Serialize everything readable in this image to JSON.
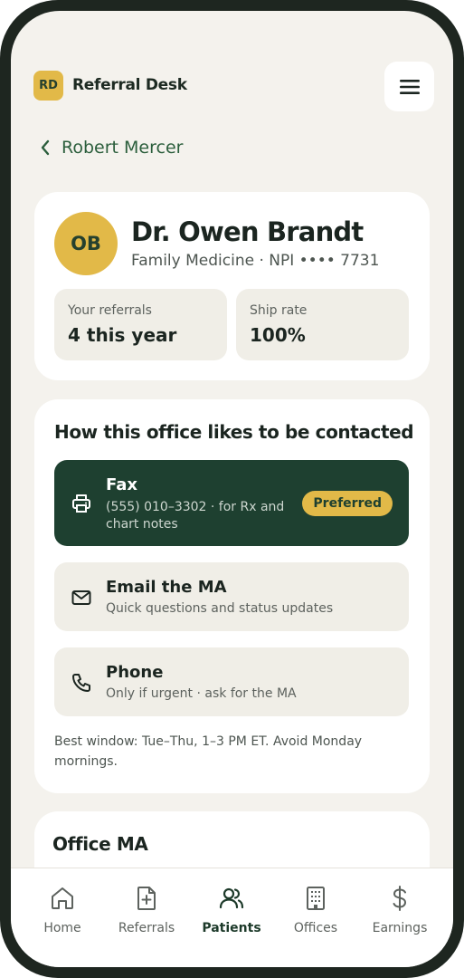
{
  "header": {
    "logo_initials": "RD",
    "app_name": "Referral Desk",
    "menu_icon": "hamburger-menu-icon"
  },
  "back": {
    "label": "Robert Mercer",
    "icon": "chevron-left-icon"
  },
  "profile": {
    "initials": "OB",
    "name": "Dr. Owen Brandt",
    "subtitle": "Family Medicine · NPI •••• 7731",
    "stats": [
      {
        "label": "Your referrals",
        "value": "4 this year"
      },
      {
        "label": "Ship rate",
        "value": "100%"
      }
    ]
  },
  "contact": {
    "title": "How this office likes to be contacted",
    "methods": [
      {
        "icon": "printer-icon",
        "title": "Fax",
        "desc": "(555) 010–3302 · for Rx and chart notes",
        "badge": "Preferred"
      },
      {
        "icon": "mail-icon",
        "title": "Email the MA",
        "desc": "Quick questions and status updates"
      },
      {
        "icon": "phone-icon",
        "title": "Phone",
        "desc": "Only if urgent · ask for the MA"
      }
    ],
    "note": "Best window: Tue–Thu, 1–3 PM ET. Avoid Monday mornings."
  },
  "office_ma": {
    "title": "Office MA"
  },
  "nav": {
    "items": [
      {
        "label": "Home",
        "icon": "home-icon"
      },
      {
        "label": "Referrals",
        "icon": "file-plus-icon"
      },
      {
        "label": "Patients",
        "icon": "users-icon",
        "active": true
      },
      {
        "label": "Offices",
        "icon": "building-icon"
      },
      {
        "label": "Earnings",
        "icon": "dollar-icon"
      }
    ]
  },
  "colors": {
    "brand_gold": "#e2b948",
    "brand_green": "#1e4030",
    "accent_green": "#2b5e3c",
    "background": "#f4f2ed"
  }
}
